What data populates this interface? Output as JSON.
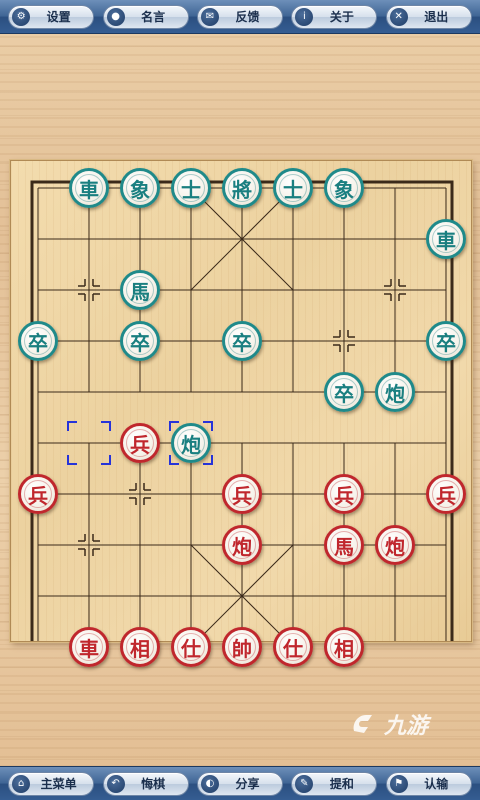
{
  "toolbar_top": {
    "buttons": [
      {
        "name": "settings-button",
        "icon": "gear-icon",
        "glyph": "⚙",
        "label": "设置"
      },
      {
        "name": "quotes-button",
        "icon": "speech-bubble-icon",
        "glyph": "●",
        "label": "名言"
      },
      {
        "name": "feedback-button",
        "icon": "envelope-icon",
        "glyph": "✉",
        "label": "反馈"
      },
      {
        "name": "about-button",
        "icon": "info-icon",
        "glyph": "i",
        "label": "关于"
      },
      {
        "name": "exit-button",
        "icon": "close-icon",
        "glyph": "✕",
        "label": "退出"
      }
    ]
  },
  "toolbar_bottom": {
    "buttons": [
      {
        "name": "main-menu-button",
        "icon": "home-icon",
        "glyph": "⌂",
        "label": "主菜单"
      },
      {
        "name": "undo-button",
        "icon": "undo-icon",
        "glyph": "↶",
        "label": "悔棋"
      },
      {
        "name": "share-button",
        "icon": "share-icon",
        "glyph": "◐",
        "label": "分享"
      },
      {
        "name": "draw-offer-button",
        "icon": "pencil-icon",
        "glyph": "✎",
        "label": "提和"
      },
      {
        "name": "resign-button",
        "icon": "flag-icon",
        "glyph": "⚑",
        "label": "认输"
      }
    ]
  },
  "board": {
    "colors": {
      "red": "#c0272d",
      "green": "#1a7f80",
      "line": "#3b2a1a"
    },
    "pieces": [
      {
        "char": "車",
        "side": "green",
        "col": 1,
        "row": 0
      },
      {
        "char": "象",
        "side": "green",
        "col": 2,
        "row": 0
      },
      {
        "char": "士",
        "side": "green",
        "col": 3,
        "row": 0
      },
      {
        "char": "將",
        "side": "green",
        "col": 4,
        "row": 0
      },
      {
        "char": "士",
        "side": "green",
        "col": 5,
        "row": 0
      },
      {
        "char": "象",
        "side": "green",
        "col": 6,
        "row": 0
      },
      {
        "char": "車",
        "side": "green",
        "col": 8,
        "row": 1
      },
      {
        "char": "馬",
        "side": "green",
        "col": 2,
        "row": 2
      },
      {
        "char": "卒",
        "side": "green",
        "col": 0,
        "row": 3
      },
      {
        "char": "卒",
        "side": "green",
        "col": 2,
        "row": 3
      },
      {
        "char": "卒",
        "side": "green",
        "col": 4,
        "row": 3
      },
      {
        "char": "卒",
        "side": "green",
        "col": 8,
        "row": 3
      },
      {
        "char": "卒",
        "side": "green",
        "col": 6,
        "row": 4
      },
      {
        "char": "炮",
        "side": "green",
        "col": 7,
        "row": 4
      },
      {
        "char": "炮",
        "side": "green",
        "col": 3,
        "row": 5
      },
      {
        "char": "兵",
        "side": "red",
        "col": 2,
        "row": 5
      },
      {
        "char": "兵",
        "side": "red",
        "col": 0,
        "row": 6
      },
      {
        "char": "兵",
        "side": "red",
        "col": 4,
        "row": 6
      },
      {
        "char": "兵",
        "side": "red",
        "col": 6,
        "row": 6
      },
      {
        "char": "兵",
        "side": "red",
        "col": 8,
        "row": 6
      },
      {
        "char": "炮",
        "side": "red",
        "col": 4,
        "row": 7
      },
      {
        "char": "馬",
        "side": "red",
        "col": 6,
        "row": 7
      },
      {
        "char": "炮",
        "side": "red",
        "col": 7,
        "row": 7
      },
      {
        "char": "車",
        "side": "red",
        "col": 1,
        "row": 9
      },
      {
        "char": "相",
        "side": "red",
        "col": 2,
        "row": 9
      },
      {
        "char": "仕",
        "side": "red",
        "col": 3,
        "row": 9
      },
      {
        "char": "帥",
        "side": "red",
        "col": 4,
        "row": 9
      },
      {
        "char": "仕",
        "side": "red",
        "col": 5,
        "row": 9
      },
      {
        "char": "相",
        "side": "red",
        "col": 6,
        "row": 9
      }
    ],
    "last_move": {
      "from": {
        "col": 1,
        "row": 5
      },
      "to": {
        "col": 3,
        "row": 5
      }
    }
  },
  "watermark": {
    "text": "九游"
  }
}
